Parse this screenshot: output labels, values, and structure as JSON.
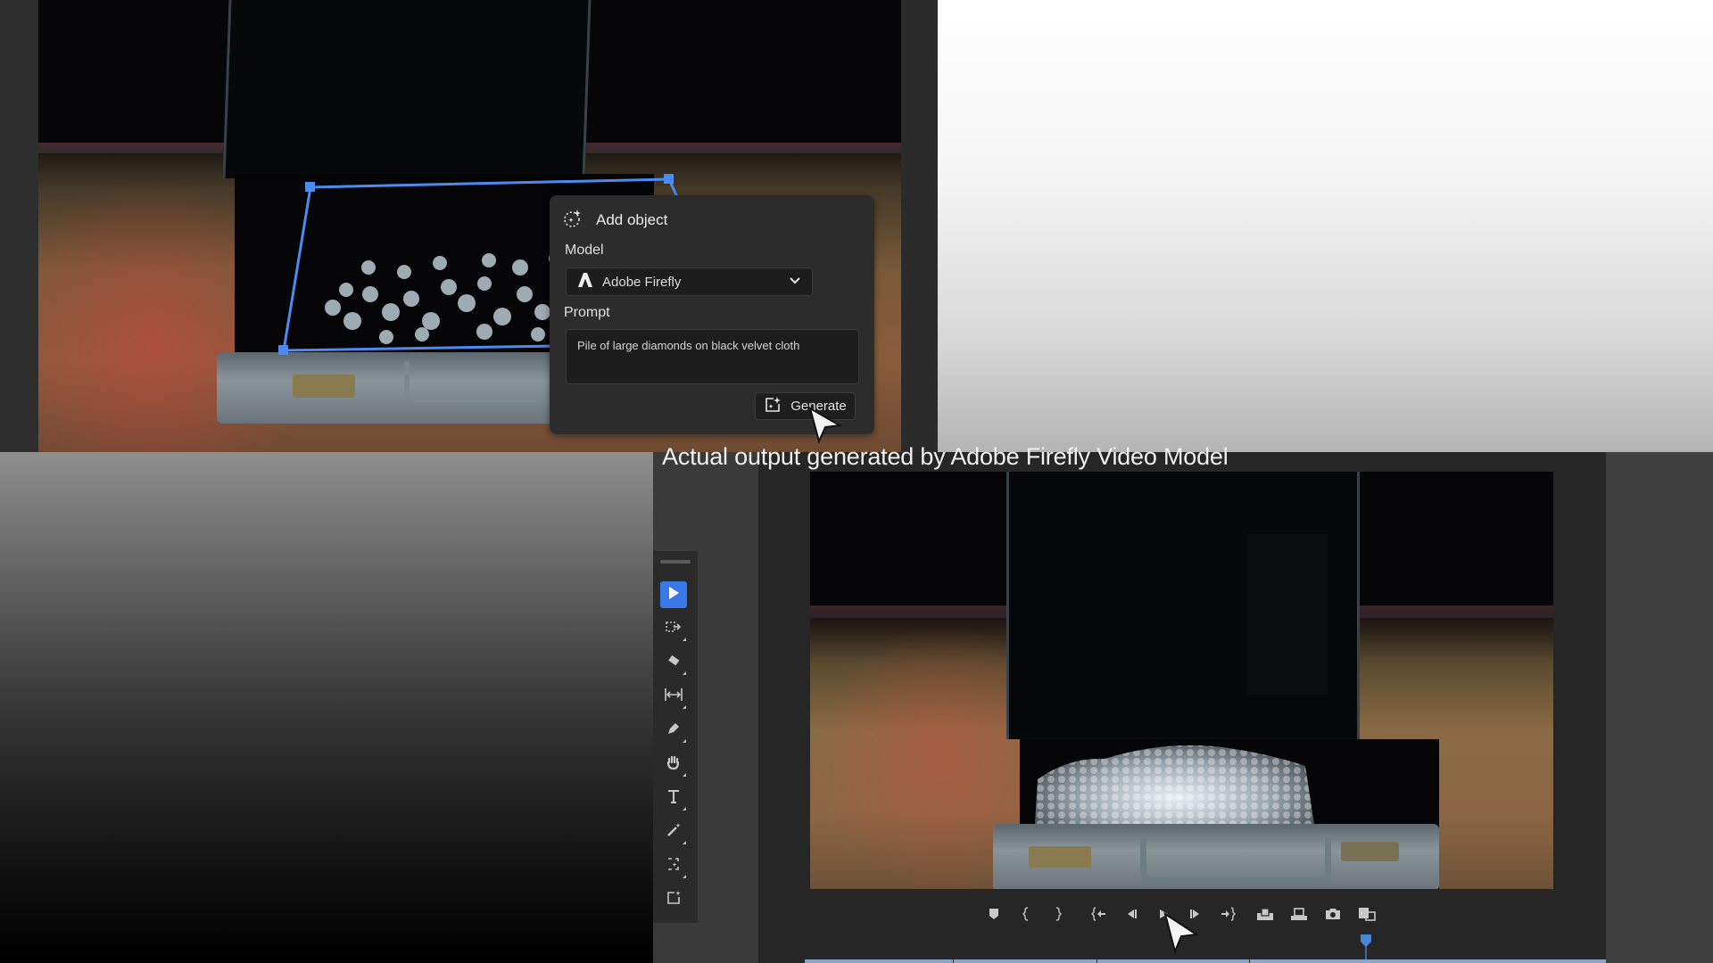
{
  "add_object_panel": {
    "title": "Add object",
    "title_icon": "sparkle-dashed-circle-icon",
    "model_label": "Model",
    "model_value": "Adobe Firefly",
    "model_icon": "adobe-firefly-logo-icon",
    "prompt_label": "Prompt",
    "prompt_value": "Pile of large diamonds on black velvet cloth",
    "generate_label": "Generate",
    "generate_icon": "generative-sparkle-icon"
  },
  "bottom_section": {
    "heading": "Actual output generated by Adobe Firefly Video Model"
  },
  "toolbar": {
    "tools": [
      {
        "name": "selection-tool",
        "icon": "arrow-pointer-icon",
        "active": true
      },
      {
        "name": "track-select-forward-tool",
        "icon": "track-select-icon",
        "active": false
      },
      {
        "name": "razor-tool",
        "icon": "razor-icon",
        "active": false
      },
      {
        "name": "slip-tool",
        "icon": "slip-icon",
        "active": false
      },
      {
        "name": "pen-tool",
        "icon": "pen-icon",
        "active": false
      },
      {
        "name": "hand-tool",
        "icon": "hand-icon",
        "active": false
      },
      {
        "name": "type-tool",
        "icon": "type-icon",
        "active": false
      },
      {
        "name": "magic-wand-tool",
        "icon": "magic-wand-icon",
        "active": false
      },
      {
        "name": "generative-extend-tool",
        "icon": "generative-extend-icon",
        "active": false
      },
      {
        "name": "generative-fill-tool",
        "icon": "generative-fill-icon",
        "active": false
      }
    ]
  },
  "transport_controls": [
    {
      "name": "add-marker",
      "icon": "marker-icon"
    },
    {
      "name": "mark-in",
      "icon": "mark-in-icon"
    },
    {
      "name": "mark-out",
      "icon": "mark-out-icon"
    },
    {
      "name": "go-to-in",
      "icon": "go-to-in-icon"
    },
    {
      "name": "step-back",
      "icon": "step-back-icon"
    },
    {
      "name": "play",
      "icon": "play-icon"
    },
    {
      "name": "step-forward",
      "icon": "step-forward-icon"
    },
    {
      "name": "go-to-out",
      "icon": "go-to-out-icon"
    },
    {
      "name": "insert",
      "icon": "insert-icon"
    },
    {
      "name": "overwrite",
      "icon": "overwrite-icon"
    },
    {
      "name": "export-frame",
      "icon": "camera-icon"
    },
    {
      "name": "comparison-view",
      "icon": "comparison-view-icon"
    }
  ],
  "colors": {
    "accent": "#3b78e7",
    "selection": "#4a8cf0",
    "panel_bg": "#2c2c2c",
    "field_bg": "#1d1d1d",
    "timeline": "#8aa4c8"
  }
}
